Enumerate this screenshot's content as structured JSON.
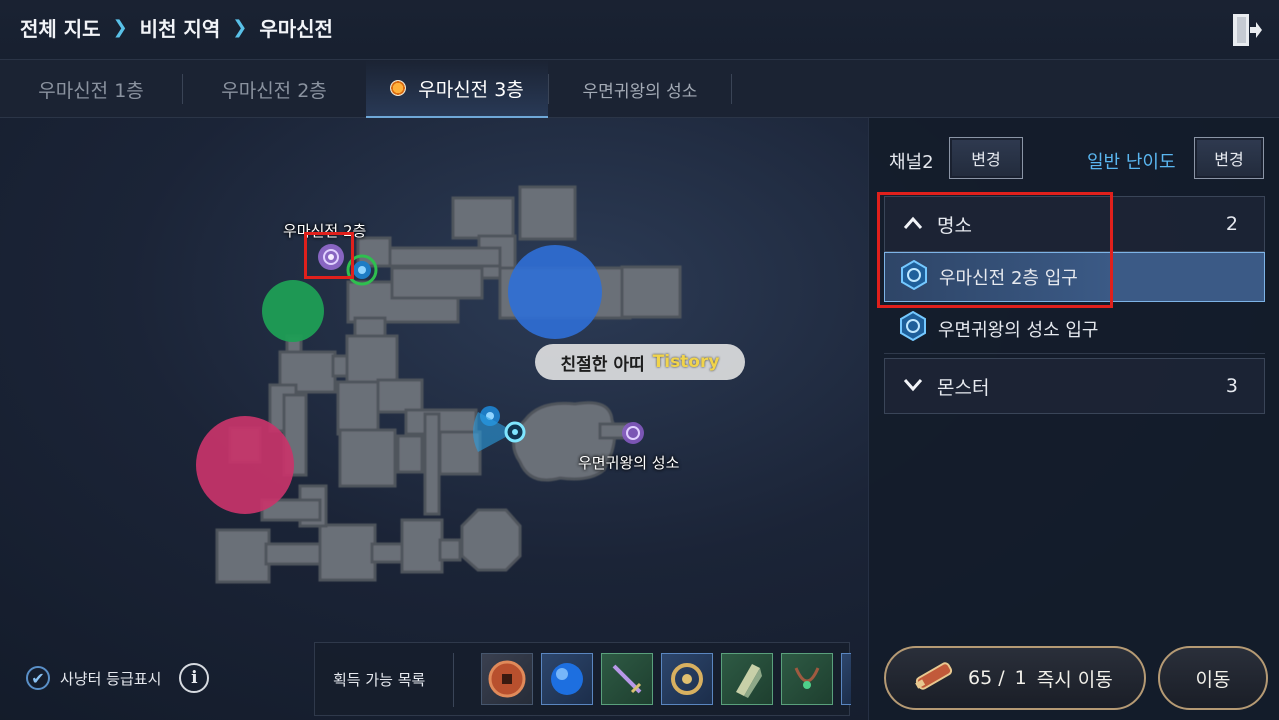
{
  "breadcrumb": [
    "전체 지도",
    "비천 지역",
    "우마신전"
  ],
  "tabs": [
    {
      "label": "우마신전 1층"
    },
    {
      "label": "우마신전 2층"
    },
    {
      "label": "우마신전 3층"
    },
    {
      "label": "우면귀왕의 성소"
    }
  ],
  "active_tab": "우마신전 3층",
  "map": {
    "labels": [
      "우마신전 2층",
      "우면귀왕의 성소"
    ],
    "watermark": {
      "text": "친절한 아띠",
      "brand": "Tistory"
    },
    "zone_colors": {
      "green": "#1f9e55",
      "blue": "#2f6fd6",
      "red": "#c8346a"
    }
  },
  "panel": {
    "channel": "채널2",
    "channel_change": "변경",
    "difficulty": "일반 난이도",
    "difficulty_change": "변경",
    "places": {
      "title": "명소",
      "count": "2"
    },
    "place_items": [
      "우마신전 2층 입구",
      "우면귀왕의 성소 입구"
    ],
    "monsters": {
      "title": "몬스터",
      "count": "3"
    }
  },
  "bottom": {
    "hunting_grade_label": "사냥터 등급표시",
    "acquirable_label": "획득 가능 목록",
    "instant_move": {
      "count": "65 /",
      "need": "1",
      "label": "즉시 이동"
    },
    "move_label": "이동"
  }
}
